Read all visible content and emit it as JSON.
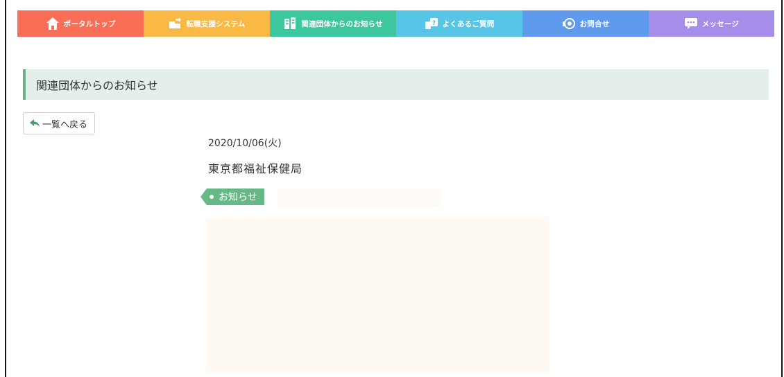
{
  "nav": {
    "items": [
      {
        "label": "ポータルトップ",
        "icon": "home-icon",
        "color": "#fa6e58"
      },
      {
        "label": "転職支援システム",
        "icon": "transfer-icon",
        "color": "#fab944"
      },
      {
        "label": "関連団体からのお知らせ",
        "icon": "building-icon",
        "color": "#3dc79f"
      },
      {
        "label": "よくあるご質問",
        "icon": "question-icon",
        "color": "#57c5e6"
      },
      {
        "label": "お問合せ",
        "icon": "headset-icon",
        "color": "#609aec"
      },
      {
        "label": "メッセージ",
        "icon": "chat-icon",
        "color": "#a48ee9"
      }
    ]
  },
  "section": {
    "title": "関連団体からのお知らせ",
    "accent": "#6fb089",
    "background": "#e3efe8"
  },
  "back_button": {
    "label": "一覧へ戻る",
    "icon": "reply-arrow-icon"
  },
  "article": {
    "date": "2020/10/06(火)",
    "organization": "東京都福祉保健局",
    "tag": {
      "label": "お知らせ",
      "color": "#66b985"
    }
  }
}
